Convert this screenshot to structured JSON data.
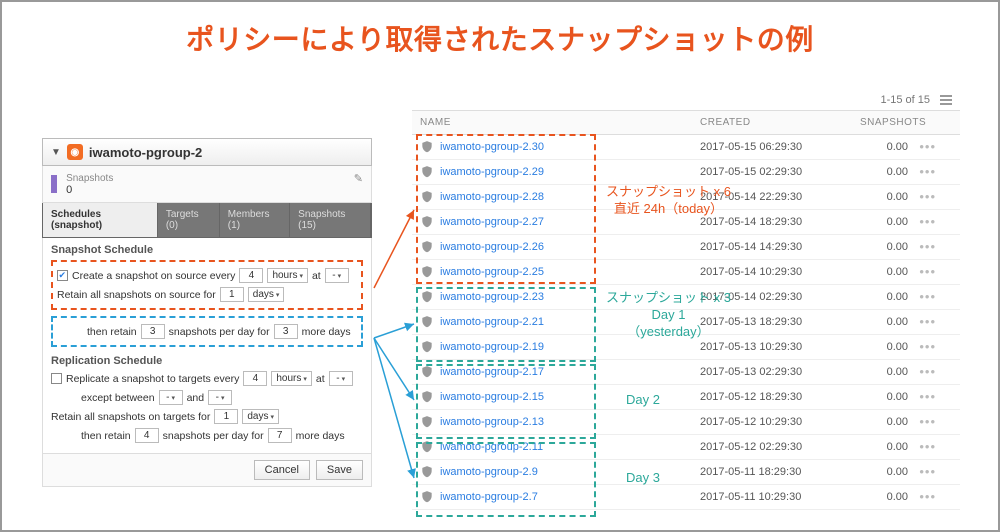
{
  "title": "ポリシーにより取得されたスナップショットの例",
  "panel": {
    "name": "iwamoto-pgroup-2",
    "snapshots_label": "Snapshots",
    "snapshots_count": "0",
    "tabs": {
      "schedules": "Schedules (snapshot)",
      "targets": "Targets (0)",
      "members": "Members (1)",
      "snapshots": "Snapshots (15)"
    },
    "snapshot_schedule_title": "Snapshot Schedule",
    "create_label_pre": "Create a snapshot on source every",
    "create_value": "4",
    "create_unit": "hours",
    "create_at": "at",
    "create_at_value": "-",
    "retain_pre": "Retain all snapshots on source for",
    "retain_value": "1",
    "retain_unit": "days",
    "then_retain_pre": "then retain",
    "then_retain_value": "3",
    "then_retain_mid": "snapshots per day for",
    "then_retain_value2": "3",
    "then_retain_post": "more days",
    "replication_title": "Replication Schedule",
    "repl_create_pre": "Replicate a snapshot to targets every",
    "repl_value": "4",
    "repl_unit": "hours",
    "repl_at": "at",
    "repl_at_value": "-",
    "except_pre": "except between",
    "except_v1": "-",
    "except_and": "and",
    "except_v2": "-",
    "repl_retain_pre": "Retain all snapshots on targets for",
    "repl_retain_value": "1",
    "repl_retain_unit": "days",
    "repl_then_pre": "then retain",
    "repl_then_v1": "4",
    "repl_then_mid": "snapshots per day for",
    "repl_then_v2": "7",
    "repl_then_post": "more days",
    "cancel": "Cancel",
    "save": "Save"
  },
  "table": {
    "paging": "1-15 of 15",
    "head_name": "NAME",
    "head_created": "CREATED",
    "head_snapshots": "SNAPSHOTS",
    "rows": [
      {
        "name": "iwamoto-pgroup-2.30",
        "created": "2017-05-15 06:29:30",
        "snap": "0.00"
      },
      {
        "name": "iwamoto-pgroup-2.29",
        "created": "2017-05-15 02:29:30",
        "snap": "0.00"
      },
      {
        "name": "iwamoto-pgroup-2.28",
        "created": "2017-05-14 22:29:30",
        "snap": "0.00"
      },
      {
        "name": "iwamoto-pgroup-2.27",
        "created": "2017-05-14 18:29:30",
        "snap": "0.00"
      },
      {
        "name": "iwamoto-pgroup-2.26",
        "created": "2017-05-14 14:29:30",
        "snap": "0.00"
      },
      {
        "name": "iwamoto-pgroup-2.25",
        "created": "2017-05-14 10:29:30",
        "snap": "0.00"
      },
      {
        "name": "iwamoto-pgroup-2.23",
        "created": "2017-05-14 02:29:30",
        "snap": "0.00"
      },
      {
        "name": "iwamoto-pgroup-2.21",
        "created": "2017-05-13 18:29:30",
        "snap": "0.00"
      },
      {
        "name": "iwamoto-pgroup-2.19",
        "created": "2017-05-13 10:29:30",
        "snap": "0.00"
      },
      {
        "name": "iwamoto-pgroup-2.17",
        "created": "2017-05-13 02:29:30",
        "snap": "0.00"
      },
      {
        "name": "iwamoto-pgroup-2.15",
        "created": "2017-05-12 18:29:30",
        "snap": "0.00"
      },
      {
        "name": "iwamoto-pgroup-2.13",
        "created": "2017-05-12 10:29:30",
        "snap": "0.00"
      },
      {
        "name": "iwamoto-pgroup-2.11",
        "created": "2017-05-12 02:29:30",
        "snap": "0.00"
      },
      {
        "name": "iwamoto-pgroup-2.9",
        "created": "2017-05-11 18:29:30",
        "snap": "0.00"
      },
      {
        "name": "iwamoto-pgroup-2.7",
        "created": "2017-05-11 10:29:30",
        "snap": "0.00"
      }
    ]
  },
  "annotations": {
    "g1a": "スナップショット x 6",
    "g1b": "直近 24h（today）",
    "g2a": "スナップショット x 3",
    "g2b": "Day 1",
    "g2c": "（yesterday）",
    "g3": "Day 2",
    "g4": "Day 3"
  }
}
